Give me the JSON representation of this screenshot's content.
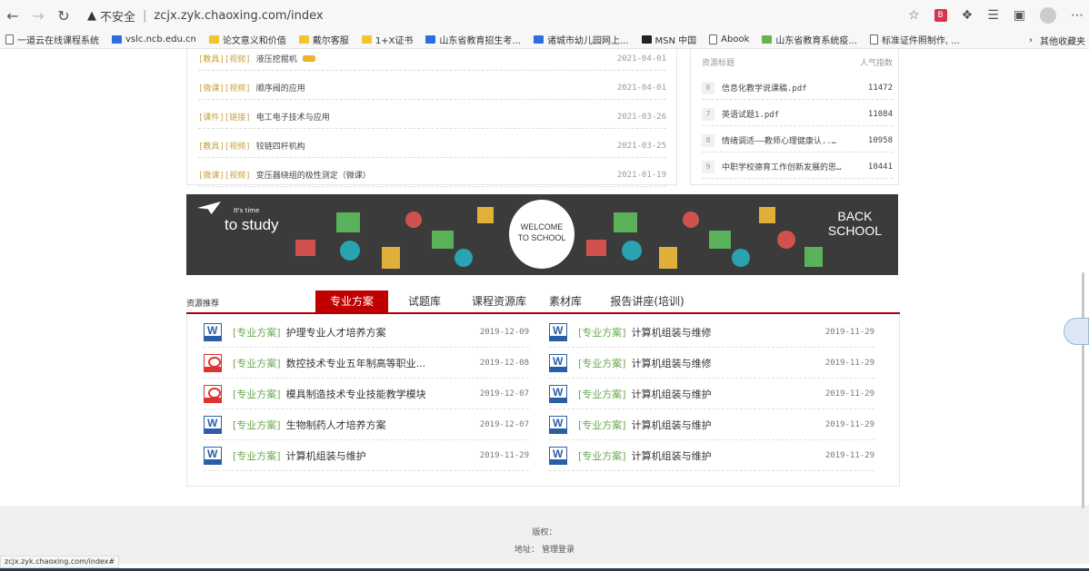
{
  "browser": {
    "url_warning": "不安全",
    "url": "zcjx.zyk.chaoxing.com/index",
    "ext_badge": "B"
  },
  "bookmarks": [
    {
      "label": "一道云在线课程系统",
      "icon": "page"
    },
    {
      "label": "vslc.ncb.edu.cn",
      "icon": "blue"
    },
    {
      "label": "论文意义和价值",
      "icon": "folder"
    },
    {
      "label": "戴尔客服",
      "icon": "folder"
    },
    {
      "label": "1+X证书",
      "icon": "folder"
    },
    {
      "label": "山东省教育招生考...",
      "icon": "blue"
    },
    {
      "label": "诸城市幼儿园网上...",
      "icon": "blue"
    },
    {
      "label": "MSN 中国",
      "icon": "dark"
    },
    {
      "label": "Abook",
      "icon": "page"
    },
    {
      "label": "山东省教育系统疫...",
      "icon": "green"
    },
    {
      "label": "标准证件照制作, ...",
      "icon": "page"
    }
  ],
  "bookmarks_other": "其他收藏夹",
  "news": [
    {
      "tag": "[教具][视频]",
      "title": "液压挖掘机",
      "date": "2021-04-01",
      "hot": true
    },
    {
      "tag": "[微课][视频]",
      "title": "顺序阀的应用",
      "date": "2021-04-01"
    },
    {
      "tag": "[课件][链接]",
      "title": "电工电子技术与应用",
      "date": "2021-03-26"
    },
    {
      "tag": "[教具][视频]",
      "title": "铰链四杆机构",
      "date": "2021-03-25"
    },
    {
      "tag": "[微课][视频]",
      "title": "变压器绕组的极性测定（微课）",
      "date": "2021-01-19"
    }
  ],
  "ranking": {
    "col_title": "资源标题",
    "col_score": "人气指数",
    "rows": [
      {
        "no": "6",
        "name": "信息化教学说课稿.pdf",
        "score": "11472"
      },
      {
        "no": "7",
        "name": "英语试题1.pdf",
        "score": "11084"
      },
      {
        "no": "8",
        "name": "情绪调适——教师心理健康认..…",
        "score": "10958"
      },
      {
        "no": "9",
        "name": "中职学校德育工作创新发展的思…",
        "score": "10441"
      }
    ]
  },
  "banner": {
    "its_time": "It's time",
    "to_study": "to study",
    "welcome_1": "WELCOME",
    "welcome_2": "TO SCHOOL",
    "back_1": "BACK",
    "back_2": "SCHOOL"
  },
  "tabs_title": "资源推荐",
  "tabs": [
    {
      "label": "专业方案",
      "active": true
    },
    {
      "label": "试题库"
    },
    {
      "label": "课程资源库"
    },
    {
      "label": "素材库"
    },
    {
      "label": "报告讲座(培训)"
    }
  ],
  "resources_left": [
    {
      "icon": "word",
      "cat": "[专业方案]",
      "title": "护理专业人才培养方案",
      "date": "2019-12-09"
    },
    {
      "icon": "pdf",
      "cat": "[专业方案]",
      "title": "数控技术专业五年制高等职业...",
      "date": "2019-12-08"
    },
    {
      "icon": "pdf",
      "cat": "[专业方案]",
      "title": "模具制造技术专业技能教学模块",
      "date": "2019-12-07"
    },
    {
      "icon": "word",
      "cat": "[专业方案]",
      "title": "生物制药人才培养方案",
      "date": "2019-12-07"
    },
    {
      "icon": "word",
      "cat": "[专业方案]",
      "title": "计算机组装与维护",
      "date": "2019-11-29"
    }
  ],
  "resources_right": [
    {
      "icon": "word",
      "cat": "[专业方案]",
      "title": "计算机组装与维修",
      "date": "2019-11-29"
    },
    {
      "icon": "word",
      "cat": "[专业方案]",
      "title": "计算机组装与维修",
      "date": "2019-11-29"
    },
    {
      "icon": "word",
      "cat": "[专业方案]",
      "title": "计算机组装与维护",
      "date": "2019-11-29"
    },
    {
      "icon": "word",
      "cat": "[专业方案]",
      "title": "计算机组装与维护",
      "date": "2019-11-29"
    },
    {
      "icon": "word",
      "cat": "[专业方案]",
      "title": "计算机组装与维护",
      "date": "2019-11-29"
    }
  ],
  "footer": {
    "copyright": "版权：",
    "address": "地址：",
    "admin_login": "管理登录"
  },
  "status_url": "zcjx.zyk.chaoxing.com/index#"
}
